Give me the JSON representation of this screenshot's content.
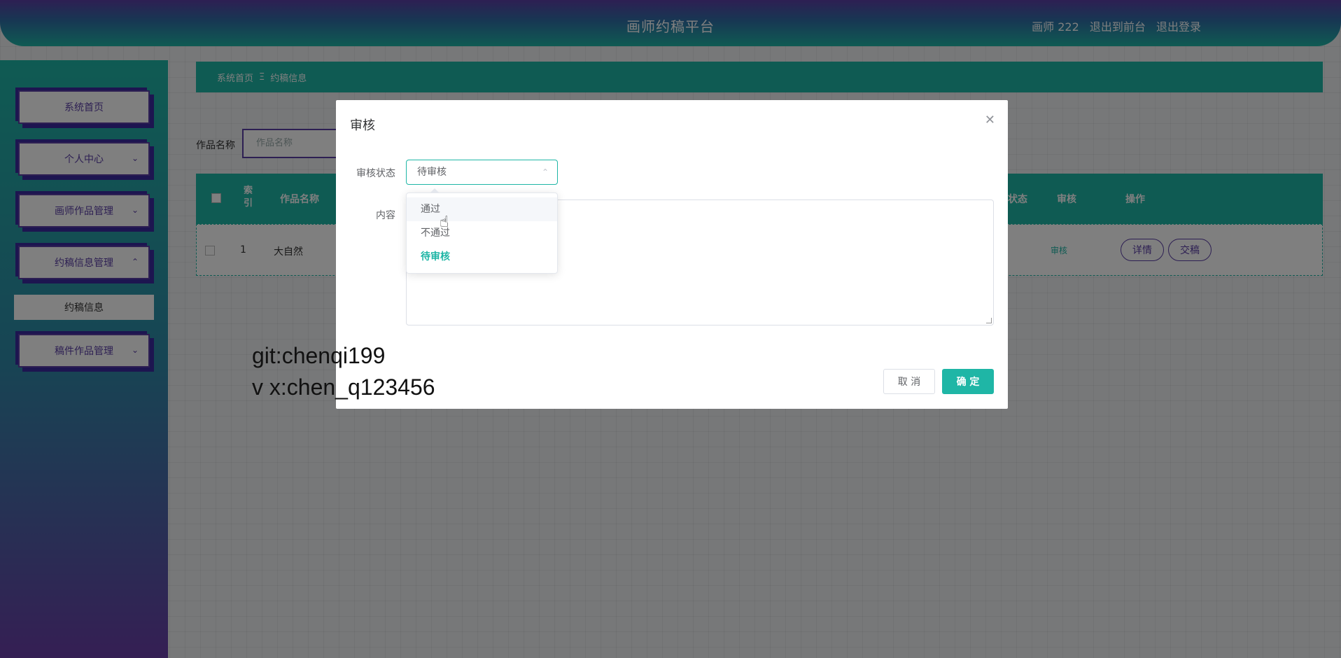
{
  "header": {
    "title": "画师约稿平台",
    "user": "画师 222",
    "back_to_front": "退出到前台",
    "logout": "退出登录"
  },
  "sidebar": {
    "items": [
      {
        "label": "系统首页"
      },
      {
        "label": "个人中心"
      },
      {
        "label": "画师作品管理"
      },
      {
        "label": "约稿信息管理"
      },
      {
        "label": "约稿信息"
      },
      {
        "label": "稿件作品管理"
      }
    ]
  },
  "breadcrumb": {
    "home": "系统首页",
    "separator": "Ξ",
    "current": "约稿信息"
  },
  "search": {
    "label": "作品名称",
    "placeholder": "作品名称"
  },
  "table": {
    "headers": {
      "index": "索引",
      "name": "作品名称",
      "status": "状态",
      "audit": "审核",
      "action": "操作"
    },
    "rows": [
      {
        "index": "1",
        "name": "大自然",
        "audit_link": "审核",
        "detail_button": "详情",
        "submit_button": "交稿"
      }
    ]
  },
  "dialog": {
    "title": "审核",
    "status_label": "审核状态",
    "status_value": "待审核",
    "content_label": "内容",
    "options": [
      "通过",
      "不通过",
      "待审核"
    ],
    "cancel_label": "取 消",
    "ok_label": "确 定",
    "accent_color": "#1fb6a6"
  },
  "watermark": {
    "line1": "git:chenqi199",
    "line2": "v x:chen_q123456"
  }
}
